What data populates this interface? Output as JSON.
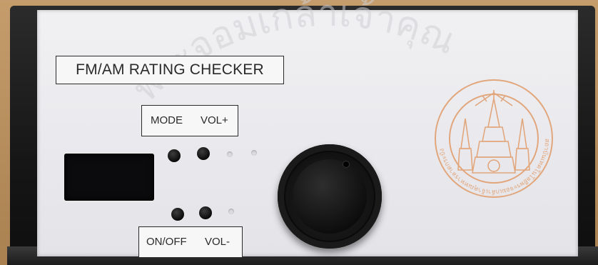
{
  "panel": {
    "title": "FM/AM RATING CHECKER",
    "top_buttons_label_mode": "MODE",
    "top_buttons_label_vol_up": "VOL+",
    "bottom_buttons_label_power": "ON/OFF",
    "bottom_buttons_label_vol_down": "VOL-"
  },
  "watermark": {
    "text": "พระจอมเกล้าเจ้าคุณ"
  },
  "seal": {
    "text": "สถาบันเทคโนโลยีพระจอมเกล้าเจ้าคุณทหารลาดกระบัง"
  },
  "colors": {
    "casing": "#1a1a1a",
    "panel": "#ececf0",
    "seal": "#e0a27a",
    "text": "#2a2a2a"
  }
}
